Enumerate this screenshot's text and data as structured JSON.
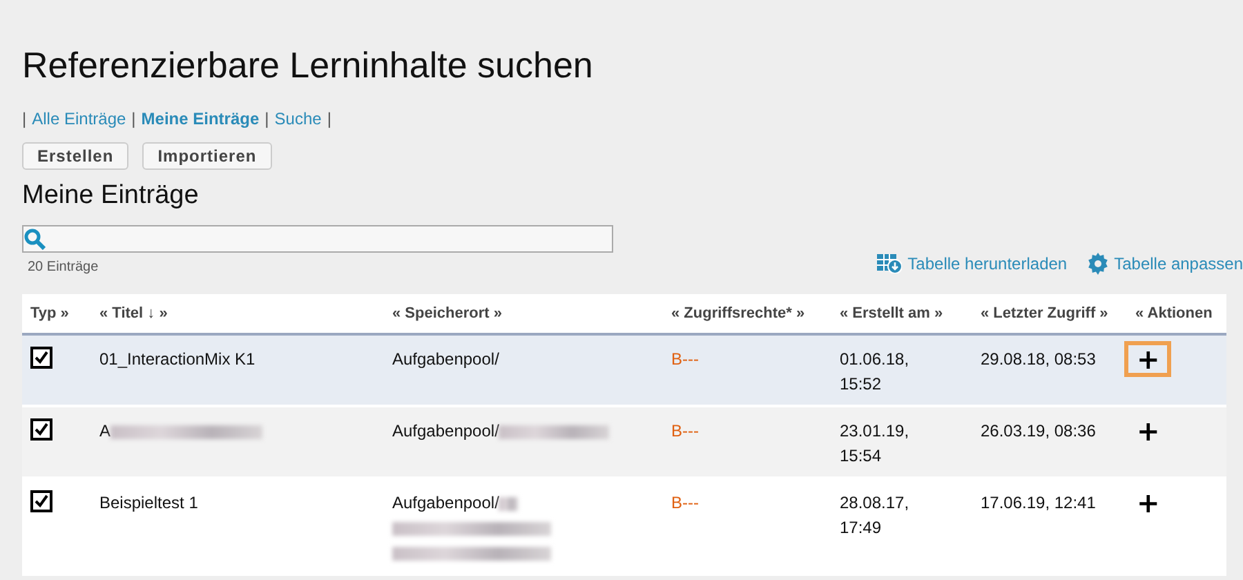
{
  "title": "Referenzierbare Lerninhalte suchen",
  "nav_separator": "|",
  "nav": [
    {
      "label": "Alle Einträge",
      "selected": false
    },
    {
      "label": "Meine Einträge",
      "selected": true
    },
    {
      "label": "Suche",
      "selected": false
    }
  ],
  "buttons": [
    "Erstellen",
    "Importieren"
  ],
  "section_title": "Meine Einträge",
  "count": "20 Einträge",
  "table_actions": [
    {
      "kind": "download",
      "label": "Tabelle herunterladen"
    },
    {
      "kind": "settings",
      "label": "Tabelle anpassen"
    }
  ],
  "table": {
    "columns": [
      "Typ »",
      "« Titel ↓ »",
      "« Speicherort »",
      "« Zugriffsrechte* »",
      "« Erstellt am »",
      "« Letzter Zugriff »",
      "« Aktionen"
    ],
    "rows": [
      {
        "highlighted": true,
        "checked": true,
        "title": "01_InteractionMix K1",
        "title_blurred": false,
        "location": "Aufgabenpool/",
        "location_blur": [],
        "rights": "B---",
        "created": [
          "01.06.18,",
          "15:52"
        ],
        "accessed": "29.08.18, 08:53",
        "action": "+",
        "action_focused": true
      },
      {
        "highlighted": false,
        "checked": true,
        "title": "A",
        "title_blurred": true,
        "location": "Aufgabenpool/",
        "location_blur": [
          {
            "kind": "long"
          }
        ],
        "rights": "B---",
        "created": [
          "23.01.19,",
          "15:54"
        ],
        "accessed": "26.03.19, 08:36",
        "action": "+",
        "action_focused": false
      },
      {
        "highlighted": false,
        "checked": true,
        "title": "Beispieltest 1",
        "title_blurred": false,
        "location": "Aufgabenpool/",
        "location_blur": [
          {
            "kind": "short"
          },
          {
            "kind": "line"
          },
          {
            "kind": "line"
          }
        ],
        "rights": "B---",
        "created": [
          "28.08.17,",
          "17:49"
        ],
        "accessed": "17.06.19, 12:41",
        "action": "+",
        "action_focused": false
      }
    ]
  }
}
